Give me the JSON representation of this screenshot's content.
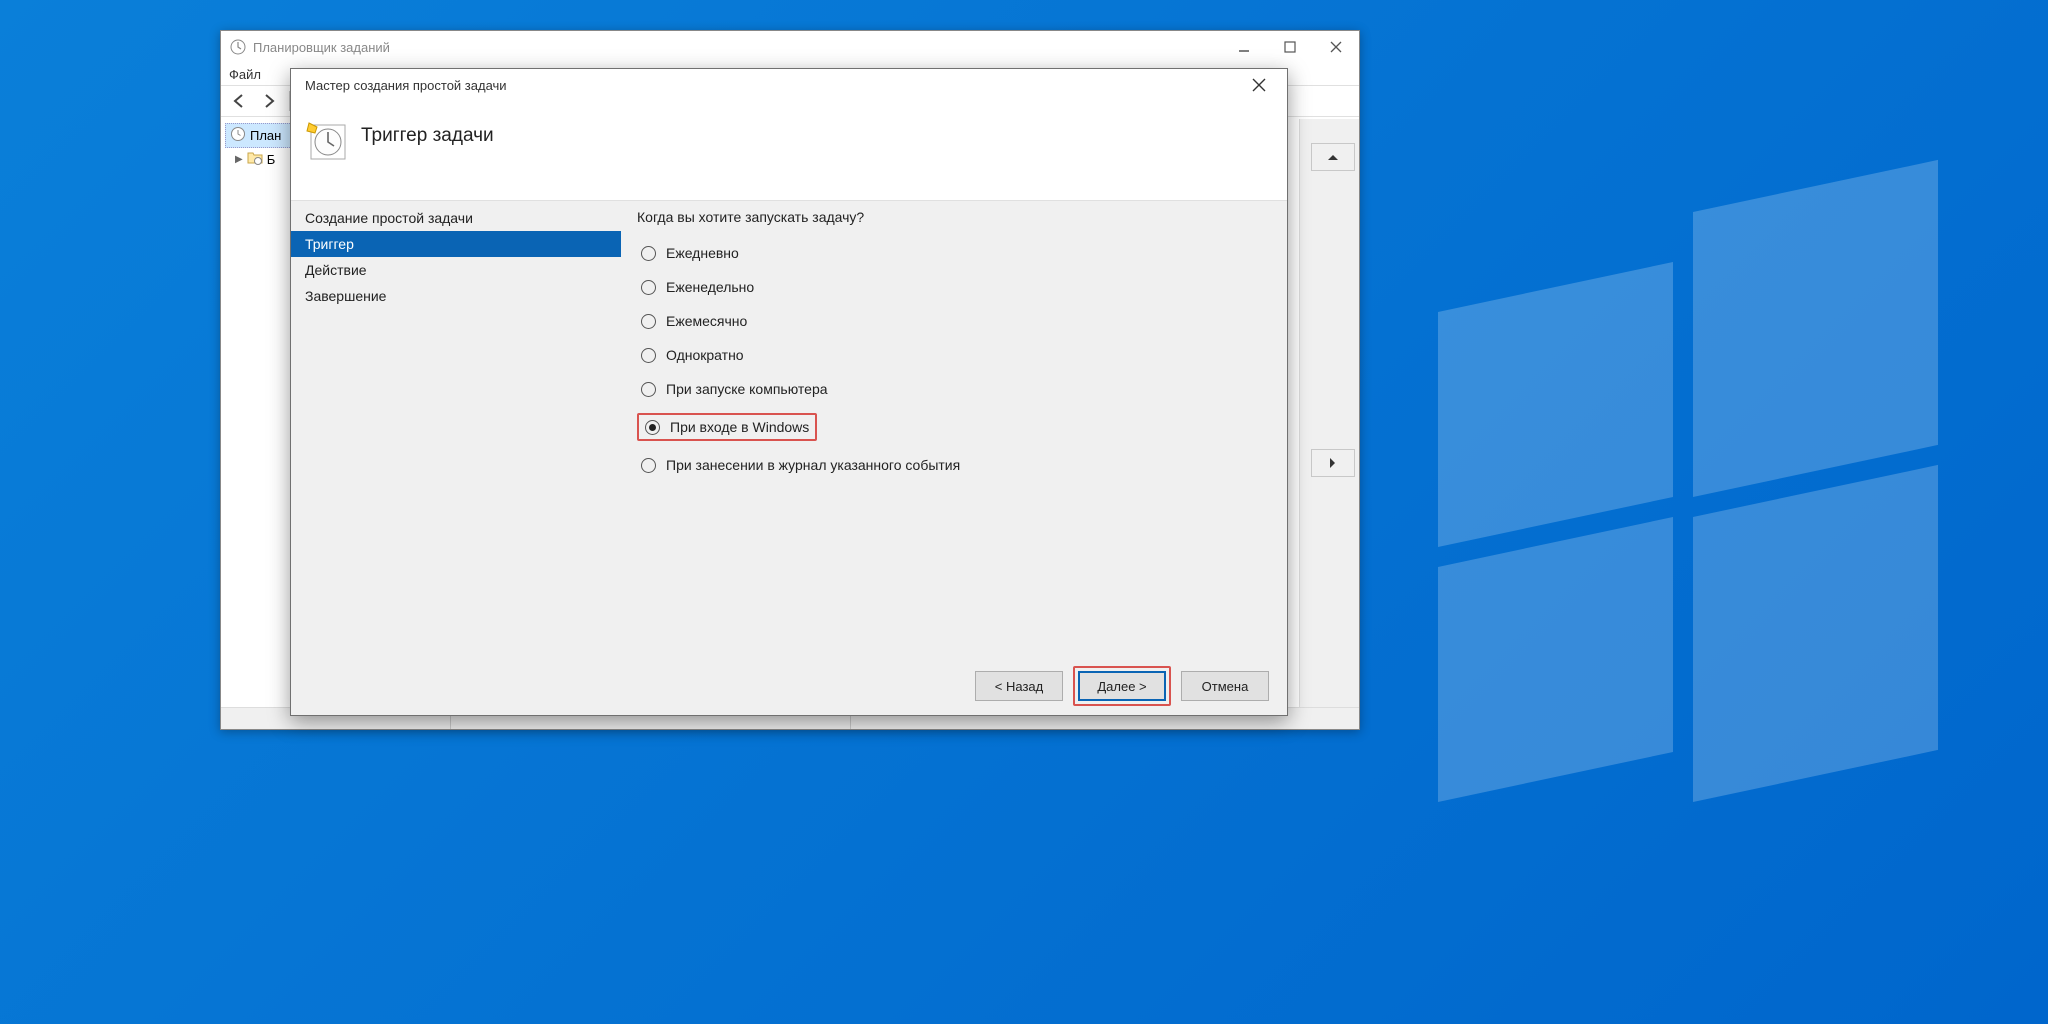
{
  "parent_window": {
    "title": "Планировщик заданий",
    "menu": {
      "file": "Файл"
    },
    "tree": {
      "root": "План",
      "library_prefix": "Б"
    }
  },
  "wizard": {
    "title": "Мастер создания простой задачи",
    "header": "Триггер задачи",
    "steps": {
      "create": "Создание простой задачи",
      "trigger": "Триггер",
      "action": "Действие",
      "finish": "Завершение"
    },
    "question": "Когда вы хотите запускать задачу?",
    "options": {
      "daily": "Ежедневно",
      "weekly": "Еженедельно",
      "monthly": "Ежемесячно",
      "once": "Однократно",
      "startup": "При запуске компьютера",
      "logon": "При входе в Windows",
      "event": "При занесении в журнал указанного события"
    },
    "buttons": {
      "back": "< Назад",
      "next": "Далее >",
      "cancel": "Отмена"
    }
  }
}
